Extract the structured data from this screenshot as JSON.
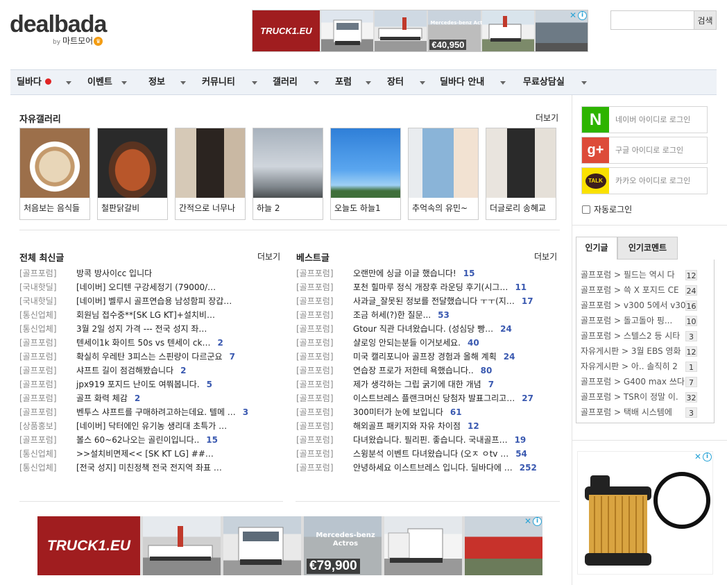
{
  "header": {
    "logo_text": "dealbada",
    "logo_by": "by",
    "logo_sub": "마트모어",
    "search_placeholder": "",
    "search_button": "검색"
  },
  "top_ad": {
    "brand": "TRUCK1.EU",
    "price": "€40,950",
    "label": "Mercedes-benz Actros"
  },
  "nav": {
    "items": [
      {
        "label": "딜바다",
        "has_dot": true
      },
      {
        "label": "이벤트"
      },
      {
        "label": "정보"
      },
      {
        "label": "커뮤니티"
      },
      {
        "label": "갤러리"
      },
      {
        "label": "포럼"
      },
      {
        "label": "장터"
      },
      {
        "label": "딜바다 안내"
      },
      {
        "label": "무료상담실"
      }
    ]
  },
  "gallery": {
    "title": "자유갤러리",
    "more": "더보기",
    "items": [
      {
        "caption": "처음보는 음식들"
      },
      {
        "caption": "철판닭갈비"
      },
      {
        "caption": "간적으로 너무나"
      },
      {
        "caption": "하늘 2"
      },
      {
        "caption": "오늘도 하늘1"
      },
      {
        "caption": "추억속의 유민~"
      },
      {
        "caption": "더글로리 송혜교"
      }
    ]
  },
  "latest": {
    "title": "전체 최신글",
    "more": "더보기",
    "rows": [
      {
        "cat": "[골프포럼]",
        "title": "방콕 방사이cc 입니다",
        "count": ""
      },
      {
        "cat": "[국내핫딜]",
        "title": "[네이버] 오디텐 구강세정기 (79000/…",
        "count": ""
      },
      {
        "cat": "[국내핫딜]",
        "title": "[네이버] 벨루시 골프연습용 남성함피 장갑…",
        "count": ""
      },
      {
        "cat": "[통신업체]",
        "title": "회원님 접수중**[SK LG KT]+설치비…",
        "count": ""
      },
      {
        "cat": "[통신업체]",
        "title": "3월 2일 성지 가격 --- 전국 성지 좌…",
        "count": ""
      },
      {
        "cat": "[골프포럼]",
        "title": "텐세이1k 화이트 50s vs 텐세이 ck…",
        "count": "2"
      },
      {
        "cat": "[골프포럼]",
        "title": "확실히 우레탄 3피스는 스핀량이 다르군요",
        "count": "7"
      },
      {
        "cat": "[골프포럼]",
        "title": "샤프트 길이 점검해봤습니다",
        "count": "2"
      },
      {
        "cat": "[골프포럼]",
        "title": "jpx919 포지드 난이도 여쭤봅니다.",
        "count": "5"
      },
      {
        "cat": "[골프포럼]",
        "title": "골프 화력 체감",
        "count": "2"
      },
      {
        "cat": "[골프포럼]",
        "title": "벤투스 샤프트를 구매하려고하는데요. 텔메 …",
        "count": "3"
      },
      {
        "cat": "[상품홍보]",
        "title": "[네이버] 닥터에인 유기농 생리대 초특가 …",
        "count": ""
      },
      {
        "cat": "[골프포럼]",
        "title": "볼스 60~62나오는 골린이입니다..",
        "count": "15"
      },
      {
        "cat": "[통신업체]",
        "title": ">>설치비면제<< [SK KT LG] ##…",
        "count": ""
      },
      {
        "cat": "[통신업체]",
        "title": "[전국 성지] 미친정책 전국 전지역 좌표 …",
        "count": ""
      }
    ]
  },
  "best": {
    "title": "베스트글",
    "more": "더보기",
    "rows": [
      {
        "cat": "[골프포럼]",
        "title": "오랜만에 싱글 이글 했습니다!",
        "count": "15"
      },
      {
        "cat": "[골프포럼]",
        "title": "포천 힐마루 정식 개장후 라운딩 후기(시그…",
        "count": "11"
      },
      {
        "cat": "[골프포럼]",
        "title": "사과글_잘못된 정보를 전달했습니다 ㅜㅜ(지…",
        "count": "17"
      },
      {
        "cat": "[골프포럼]",
        "title": "조금 허세(?)한 질문...",
        "count": "53"
      },
      {
        "cat": "[골프포럼]",
        "title": "Gtour 직관 다녀왔습니다. (성심당 빵…",
        "count": "24"
      },
      {
        "cat": "[골프포럼]",
        "title": "샬로잉 안되는분들 이거보세요.",
        "count": "40"
      },
      {
        "cat": "[골프포럼]",
        "title": "미국 캘리포니아 골프장 경험과 올해 계획",
        "count": "24"
      },
      {
        "cat": "[골프포럼]",
        "title": "연습장 프로가 저한테 욕했습니다..",
        "count": "80"
      },
      {
        "cat": "[골프포럼]",
        "title": "제가 생각하는 그립 굵기에 대한 개념",
        "count": "7"
      },
      {
        "cat": "[골프포럼]",
        "title": "이스트브레스 플랜크머신 당첨자 발표그리고…",
        "count": "27"
      },
      {
        "cat": "[골프포럼]",
        "title": "300미터가 눈에 보입니다",
        "count": "61"
      },
      {
        "cat": "[골프포럼]",
        "title": "해외골프 패키지와 자유 차이점",
        "count": "12"
      },
      {
        "cat": "[골프포럼]",
        "title": "다녀왔습니다. 필리핀. 좋습니다. 국내골프…",
        "count": "19"
      },
      {
        "cat": "[골프포럼]",
        "title": "스윙분석 이벤트 다녀왔습니다 (오ㅈ ㅇtv …",
        "count": "54"
      },
      {
        "cat": "[골프포럼]",
        "title": "안녕하세요 이스트브레스 입니다. 딜바다에 …",
        "count": "252"
      }
    ]
  },
  "login": {
    "naver": "네이버 아이디로 로그인",
    "google": "구글 아이디로 로그인",
    "kakao": "카카오 아이디로 로그인",
    "naver_icon": "N",
    "google_icon": "g+",
    "kakao_icon": "TALK",
    "auto_login": "자동로그인"
  },
  "popular": {
    "tabs": [
      "인기글",
      "인기코멘트"
    ],
    "rows": [
      {
        "text": "골프포럼 > 필드는 역시 다",
        "count": "12"
      },
      {
        "text": "골프포럼 > 쓱 X 포지드 CE",
        "count": "24"
      },
      {
        "text": "골프포럼 > v300 5에서 v30",
        "count": "16"
      },
      {
        "text": "골프포럼 > 돌고돌아 핑...",
        "count": "10"
      },
      {
        "text": "골프포럼 > 스텔스2 등 시타",
        "count": "3"
      },
      {
        "text": "자유게시판 > 3월 EBS 영화",
        "count": "12"
      },
      {
        "text": "자유게시판 > 아.. 솔직히 2",
        "count": "1"
      },
      {
        "text": "골프포럼 > G400 max 쓰다",
        "count": "7"
      },
      {
        "text": "골프포럼 > TSR이 정말 이.",
        "count": "32"
      },
      {
        "text": "골프포럼 > 택배 시스템에",
        "count": "3"
      }
    ]
  },
  "bottom_ad": {
    "brand": "TRUCK1.EU",
    "price": "€79,900",
    "label": "Mercedes-benz Actros"
  },
  "colors": {
    "nav_bg": "#eef2f7",
    "count_blue": "#3a59b0",
    "ad_red": "#a01d1f",
    "naver_green": "#2db400",
    "google_red": "#dd4b39",
    "kakao_yellow": "#fae100"
  }
}
